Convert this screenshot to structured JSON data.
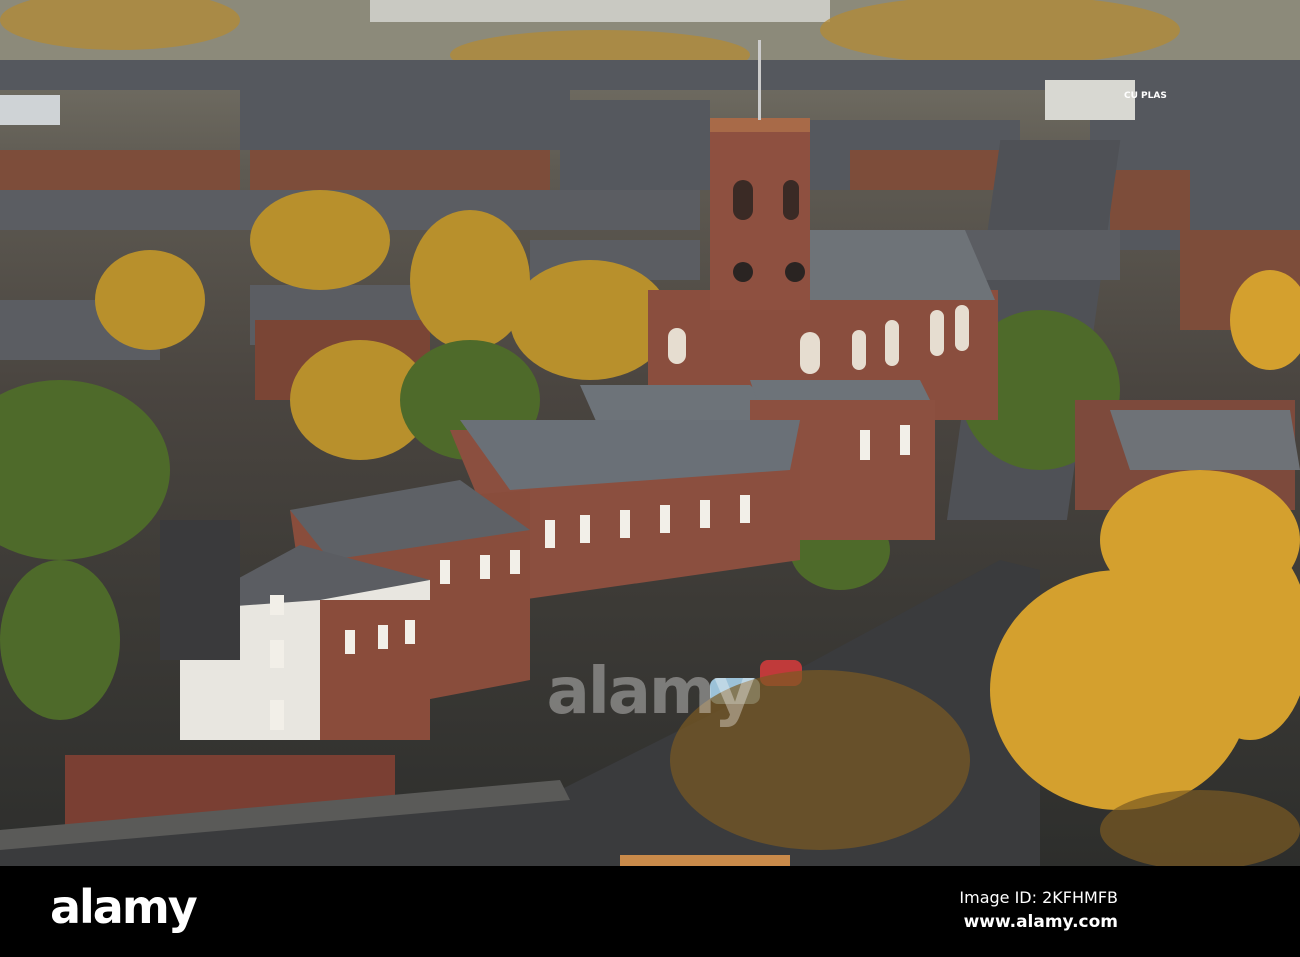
{
  "photo": {
    "sign_text": "CU PLAS",
    "watermark": "alamy"
  },
  "footer": {
    "logo": "alamy",
    "image_id": "Image ID: 2KFHMFB",
    "website": "www.alamy.com"
  },
  "colors": {
    "brick": "#8a4a38",
    "foliage": "#c79a2a",
    "slate": "#5a5d63",
    "road": "#3a3b3d"
  }
}
